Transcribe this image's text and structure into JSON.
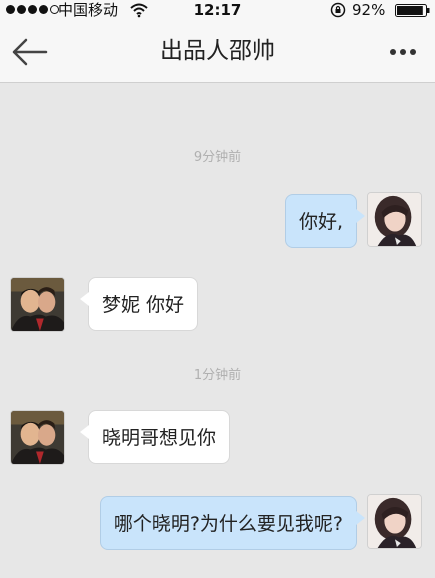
{
  "status_bar": {
    "carrier": "中国移动",
    "time": "12:17",
    "battery_percent": "92%",
    "battery_level": 0.92
  },
  "nav": {
    "title": "出品人邵帅",
    "back_icon": "back-arrow-icon",
    "more_icon": "more-dots-icon"
  },
  "messages": [
    {
      "type": "timestamp",
      "text": "9分钟前"
    },
    {
      "type": "message",
      "side": "right",
      "text": "你好,",
      "avatar": "female-avatar"
    },
    {
      "type": "message",
      "side": "left",
      "text": "梦妮 你好",
      "avatar": "male-avatar"
    },
    {
      "type": "timestamp",
      "text": "1分钟前"
    },
    {
      "type": "message",
      "side": "left",
      "text": "晓明哥想见你",
      "avatar": "male-avatar"
    },
    {
      "type": "message",
      "side": "right",
      "text": "哪个晓明?为什么要见我呢?",
      "avatar": "female-avatar"
    }
  ],
  "colors": {
    "sent_bubble": "#c9e4fb",
    "received_bubble": "#ffffff",
    "chat_background": "#e7e7e7"
  }
}
